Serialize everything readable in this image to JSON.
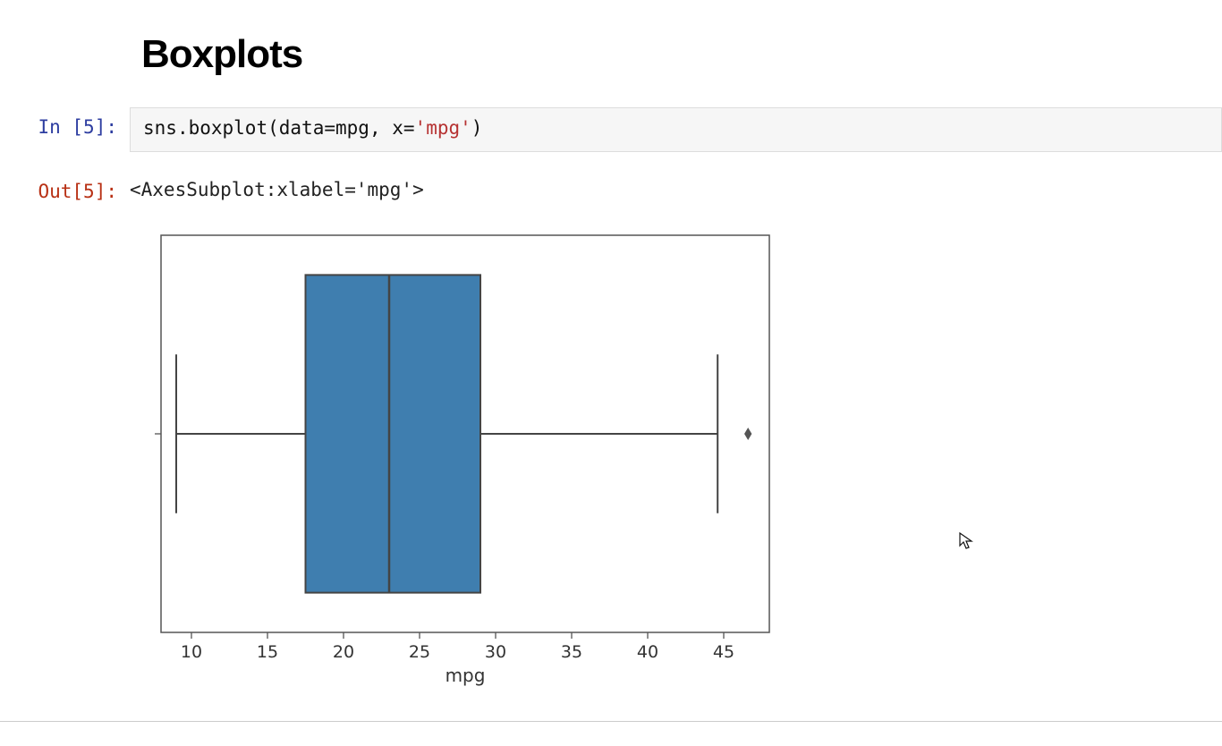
{
  "title": "Boxplots",
  "cell": {
    "in_prompt": "In [5]:",
    "out_prompt": "Out[5]:",
    "code_tokens": {
      "t1": "sns",
      "t2": ".",
      "t3": "boxplot",
      "t4": "(",
      "t5": "data",
      "t6": "=",
      "t7": "mpg",
      "t8": ", ",
      "t9": "x",
      "t10": "=",
      "t11": "'mpg'",
      "t12": ")"
    },
    "output_text": "<AxesSubplot:xlabel='mpg'>"
  },
  "chart_data": {
    "type": "boxplot",
    "orientation": "horizontal",
    "xlabel": "mpg",
    "ylabel": "",
    "xticks": [
      10,
      15,
      20,
      25,
      30,
      35,
      40,
      45
    ],
    "xlim": [
      8,
      48
    ],
    "series": [
      {
        "name": "mpg",
        "whisker_low": 9,
        "q1": 17.5,
        "median": 23,
        "q3": 29,
        "whisker_high": 44.6,
        "outliers": [
          46.6
        ]
      }
    ],
    "box_color": "#3f7eaf"
  }
}
